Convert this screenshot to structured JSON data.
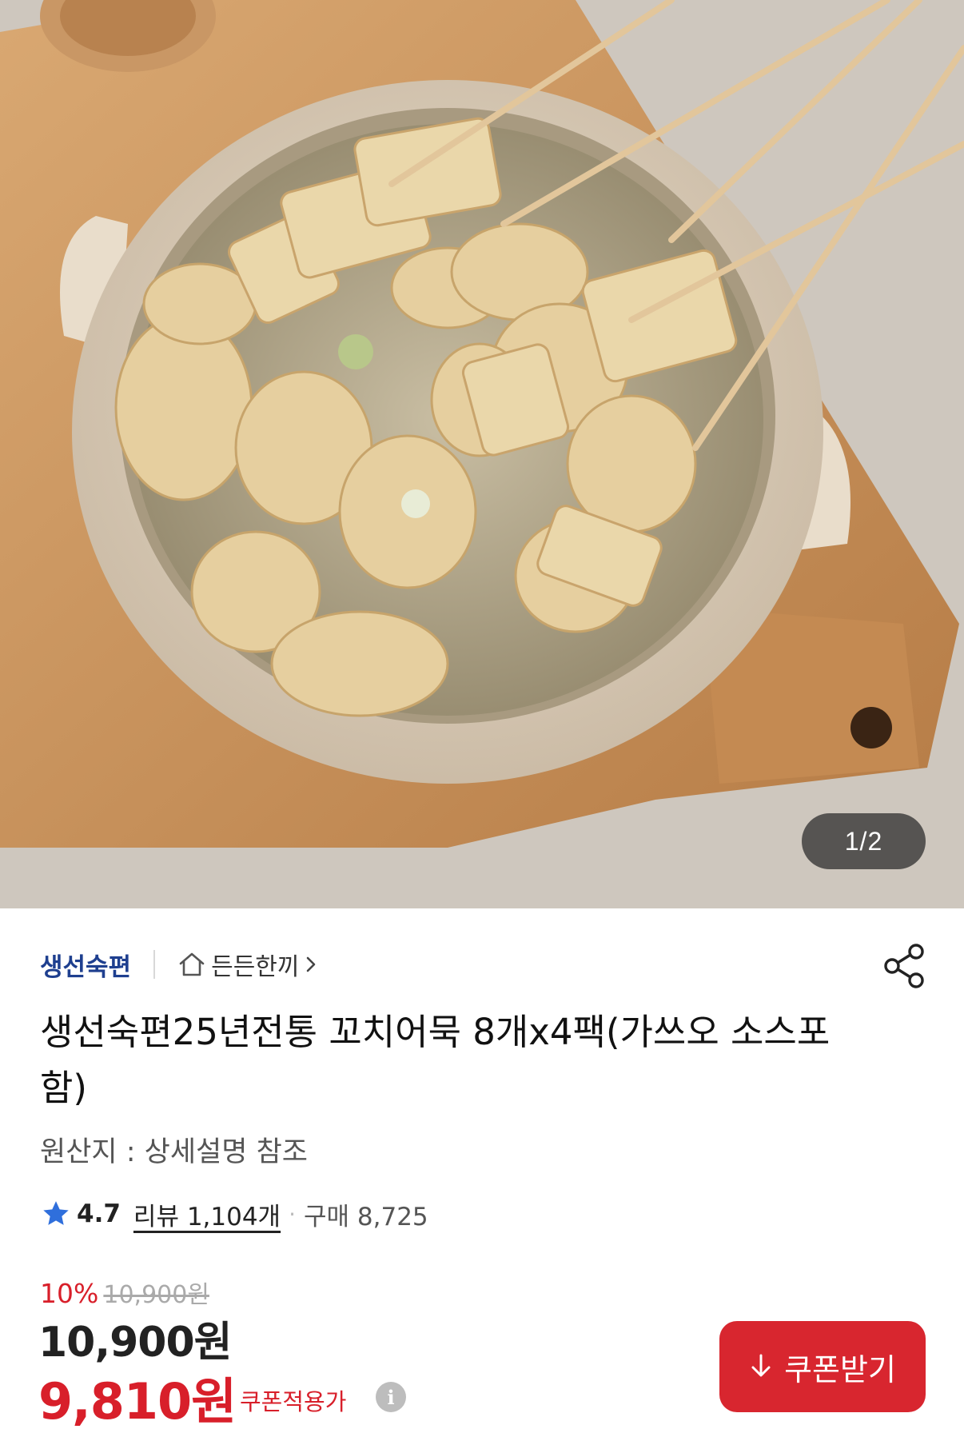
{
  "gallery": {
    "current": "1",
    "separator": " / ",
    "total": "2",
    "image_alt": "꼬치어묵 냄비"
  },
  "product": {
    "brand": "생선숙편",
    "category": "든든한끼",
    "title": "생선숙편25년전통 꼬치어묵 8개x4팩(가쓰오 소스포함)",
    "origin": "원산지 : 상세설명 참조",
    "rating": "4.7",
    "review_label": "리뷰 1,104개",
    "dot": "·",
    "purchase_label": "구매 8,725"
  },
  "price": {
    "discount_rate": "10%",
    "original": "10,900원",
    "sale": "10,900원",
    "coupon_price": "9,810원",
    "coupon_label": "쿠폰적용가",
    "info_glyph": "i"
  },
  "actions": {
    "coupon_button": "쿠폰받기"
  },
  "icons": {
    "home": "home-icon",
    "chevron": "chevron-right-icon",
    "share": "share-icon",
    "star": "star-icon",
    "info": "info-icon",
    "download": "download-icon"
  },
  "colors": {
    "brand": "#1e3f8f",
    "accent_red": "#d8262f",
    "star_blue": "#2f6fdc"
  }
}
